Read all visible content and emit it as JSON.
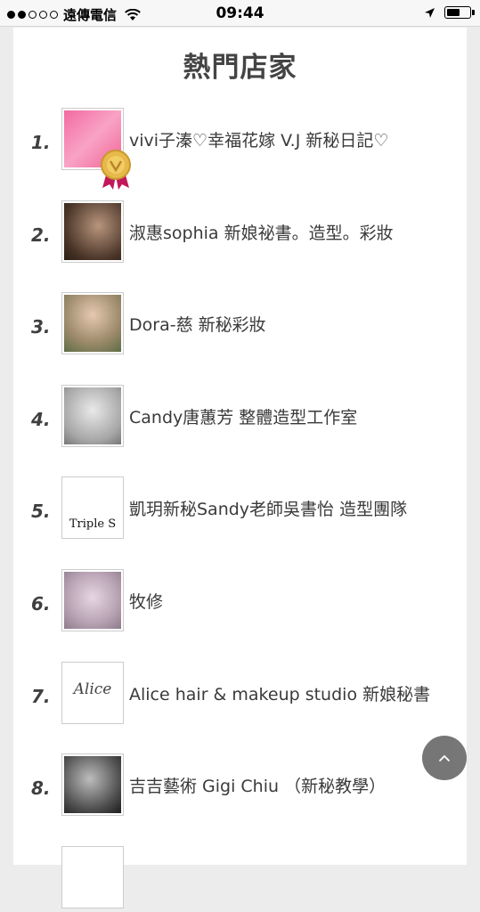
{
  "status_bar": {
    "carrier": "遠傳電信",
    "time": "09:44",
    "signal_bars_filled": 2,
    "signal_bars_total": 5,
    "battery_level": 0.6
  },
  "page": {
    "title": "熱門店家"
  },
  "shops": [
    {
      "rank": "1.",
      "name": "vivi子溱♡幸福花嫁 V.J 新秘日記♡",
      "thumb": "t1",
      "badge": true
    },
    {
      "rank": "2.",
      "name": "淑惠sophia 新娘祕書。造型。彩妝",
      "thumb": "t2",
      "badge": false
    },
    {
      "rank": "3.",
      "name": "Dora-慈 新秘彩妝",
      "thumb": "t3",
      "badge": false
    },
    {
      "rank": "4.",
      "name": "Candy唐蕙芳 整體造型工作室",
      "thumb": "t4",
      "badge": false
    },
    {
      "rank": "5.",
      "name": "凱玥新秘Sandy老師吳書怡 造型團隊",
      "thumb": "t5",
      "badge": false,
      "logo_text": "Triple S"
    },
    {
      "rank": "6.",
      "name": "牧修",
      "thumb": "t6",
      "badge": false
    },
    {
      "rank": "7.",
      "name": "Alice hair & makeup studio 新娘秘書",
      "thumb": "t7",
      "badge": false,
      "logo_text": "Alice"
    },
    {
      "rank": "8.",
      "name": "吉吉藝術 Gigi Chiu （新秘教學）",
      "thumb": "t8",
      "badge": false
    },
    {
      "rank": "",
      "name": "",
      "thumb": "t9",
      "badge": false
    }
  ],
  "icons": {
    "wifi": "wifi-icon",
    "location": "location-arrow-icon",
    "battery": "battery-icon",
    "award": "gold-medal-icon",
    "scroll_top": "chevron-up-icon"
  },
  "colors": {
    "background": "#ececec",
    "card": "#ffffff",
    "text": "#3a3a3a",
    "fab": "#6b6b6b",
    "medal_gold": "#e6b94a",
    "medal_ribbon": "#c2185b"
  }
}
